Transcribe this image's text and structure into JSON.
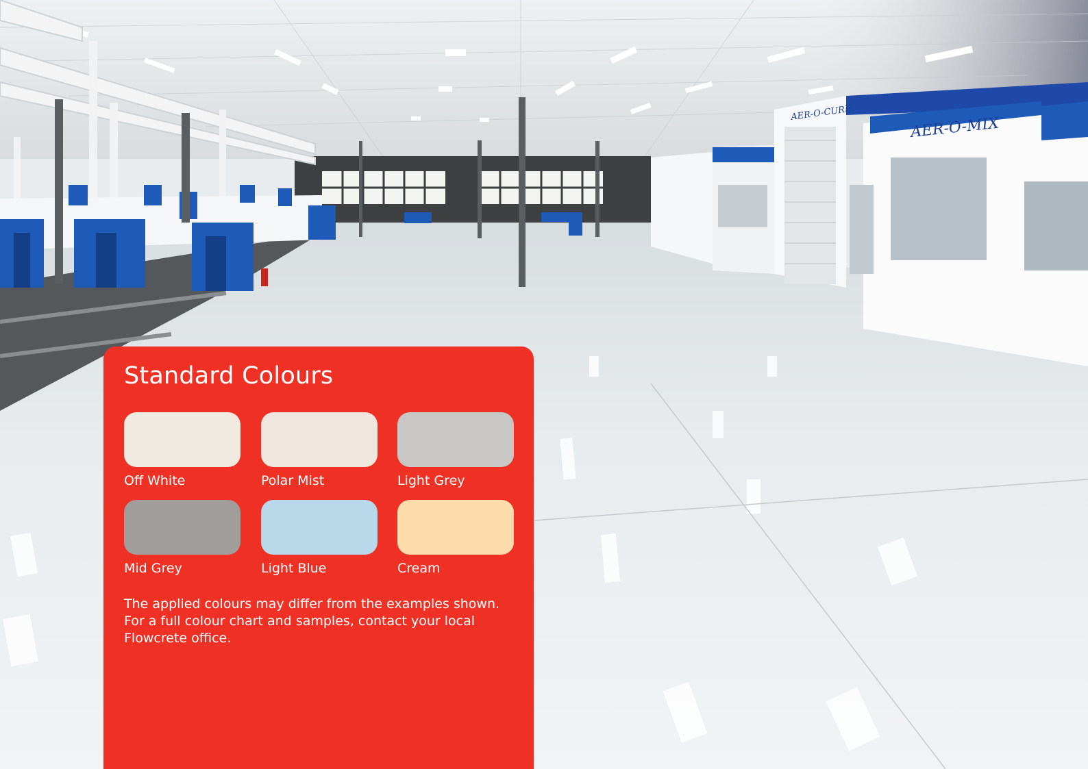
{
  "panel": {
    "title": "Standard Colours",
    "background": "#ee3124",
    "swatches": [
      {
        "label": "Off White",
        "color": "#f1eae0"
      },
      {
        "label": "Polar Mist",
        "color": "#efe6dd"
      },
      {
        "label": "Light Grey",
        "color": "#c9c7c5"
      },
      {
        "label": "Mid Grey",
        "color": "#a19d9b"
      },
      {
        "label": "Light Blue",
        "color": "#b9d9ea"
      },
      {
        "label": "Cream",
        "color": "#fcdcab"
      }
    ],
    "note_lines": [
      "The applied colours may differ from the examples shown.",
      "For a full colour chart and samples, contact your local",
      "Flowcrete office."
    ]
  },
  "photo": {
    "booth_signs": [
      "AER-O-MIX",
      "AER-O-CURE"
    ]
  }
}
